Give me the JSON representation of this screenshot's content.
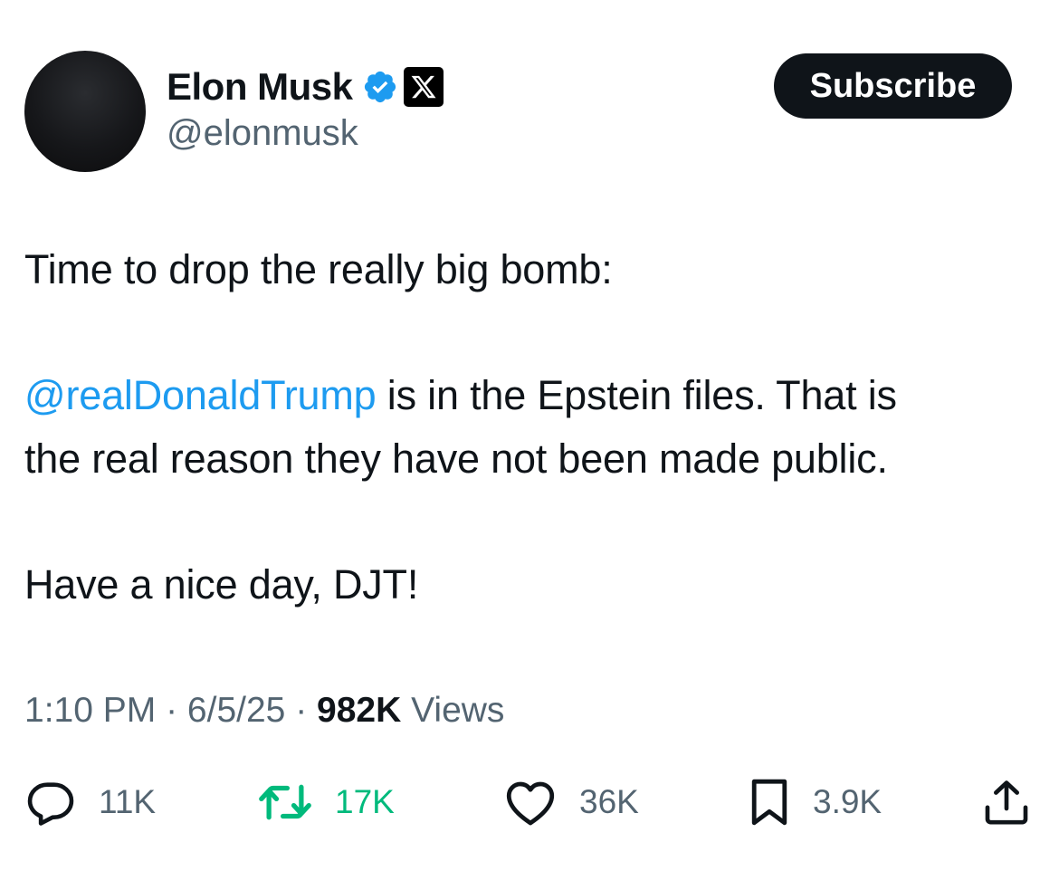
{
  "author": {
    "display_name": "Elon Musk",
    "handle": "@elonmusk",
    "verified_icon": "verified-badge-icon",
    "affiliate_icon": "x-logo-icon"
  },
  "subscribe_button": {
    "label": "Subscribe"
  },
  "tweet": {
    "line1": "Time to drop the really big bomb:",
    "mention": "@realDonaldTrump",
    "line2_rest": " is in the Epstein files. That is",
    "line3": "the real reason they have not been made public.",
    "line4": "Have a nice day, DJT!"
  },
  "meta": {
    "time": "1:10 PM",
    "separator": " · ",
    "date": "6/5/25",
    "views_count": "982K",
    "views_label": " Views"
  },
  "actions": {
    "reply": {
      "count": "11K",
      "icon": "reply-icon"
    },
    "repost": {
      "count": "17K",
      "icon": "repost-icon"
    },
    "like": {
      "count": "36K",
      "icon": "heart-icon"
    },
    "bookmark": {
      "count": "3.9K",
      "icon": "bookmark-icon"
    },
    "share": {
      "icon": "share-icon"
    }
  },
  "colors": {
    "text": "#0f1419",
    "secondary": "#536471",
    "link": "#1d9bf0",
    "repost_active": "#00ba7c",
    "verified": "#1d9bf0"
  }
}
